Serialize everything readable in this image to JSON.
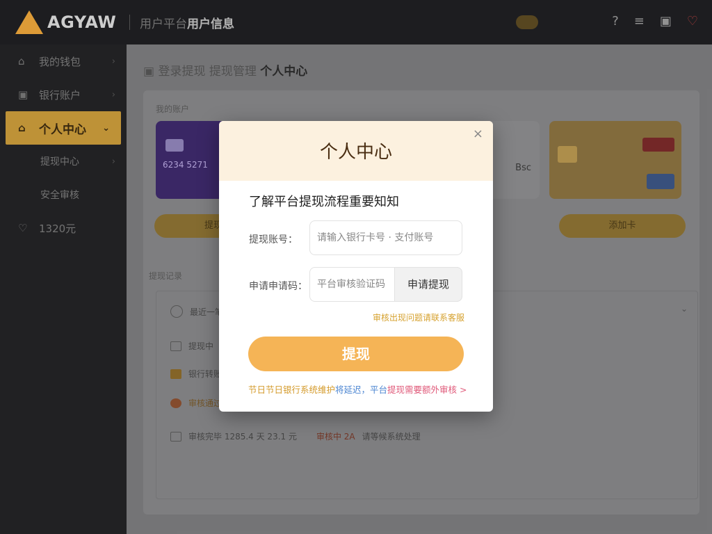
{
  "topbar": {
    "logo_text": "AGYAW",
    "title_dim": "用户平台",
    "title_bold": "用户信息",
    "icons": [
      "help-icon",
      "settings-icon",
      "store-icon",
      "heart-icon"
    ]
  },
  "sidebar": {
    "items": [
      {
        "label": "我的钱包",
        "icon": "⌂",
        "chev": "›"
      },
      {
        "label": "银行账户",
        "icon": "▣",
        "chev": "›"
      },
      {
        "label": "个人中心",
        "icon": "⌂",
        "chev": "⌄",
        "active": true
      },
      {
        "label": "提现中心",
        "icon": "",
        "chev": "›",
        "sub": true
      },
      {
        "label": "安全审核",
        "icon": "",
        "chev": "",
        "sub": true
      },
      {
        "label": "1320元",
        "icon": "♡",
        "chev": ""
      }
    ]
  },
  "main": {
    "breadcrumb_dim": "▣ 登录提现 提现管理 ",
    "breadcrumb_bold": "个人中心",
    "cards_label": "我的账户",
    "card1_number": "6234 5271",
    "card3_text": "Bsc",
    "card_button": "提现",
    "card_button_right": "添加卡",
    "records_label": "提现记录",
    "rows": [
      {
        "text": "最近一笔提现"
      },
      {
        "text": "提现中"
      },
      {
        "text": "银行转账中"
      },
      {
        "text": "审核通过 · 到账中"
      },
      {
        "text": "审核完毕 1285.4 天 23.1 元",
        "status": "审核中 2A",
        "note": "请等候系统处理"
      }
    ]
  },
  "modal": {
    "title": "个人中心",
    "close": "×",
    "subtitle": "了解平台提现流程重要知知",
    "field1_label": "提现账号：",
    "field1_placeholder": "请输入银行卡号 · 支付账号",
    "field2_label": "申请申请码：",
    "field2_placeholder": "平台审核验证码",
    "field2_button": "申请提现",
    "hint": "审核出现问题请联系客服",
    "primary_button": "提现",
    "note_part1": "节日节日银行系统维护",
    "note_part2": "将延迟，平台",
    "note_part3": "提现需要额外审核 >"
  }
}
